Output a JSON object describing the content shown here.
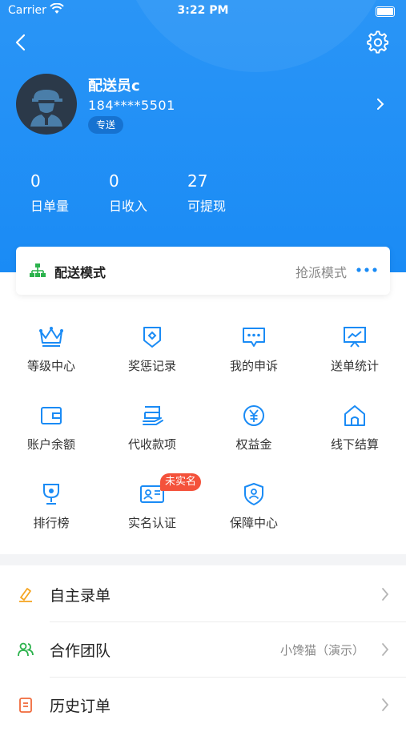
{
  "status_bar": {
    "carrier": "Carrier",
    "time": "3:22 PM"
  },
  "profile": {
    "name": "配送员c",
    "phone": "184****5501",
    "badge": "专送"
  },
  "stats": [
    {
      "value": "0",
      "label": "日单量"
    },
    {
      "value": "0",
      "label": "日收入"
    },
    {
      "value": "27",
      "label": "可提现"
    }
  ],
  "delivery_mode": {
    "title": "配送模式",
    "value": "抢派模式"
  },
  "grid": [
    {
      "label": "等级中心",
      "icon": "crown-icon"
    },
    {
      "label": "奖惩记录",
      "icon": "shield-badge-icon"
    },
    {
      "label": "我的申诉",
      "icon": "chat-bubble-icon"
    },
    {
      "label": "送单统计",
      "icon": "chart-board-icon"
    },
    {
      "label": "账户余额",
      "icon": "wallet-icon"
    },
    {
      "label": "代收款项",
      "icon": "collection-icon"
    },
    {
      "label": "权益金",
      "icon": "yuan-coin-icon"
    },
    {
      "label": "线下结算",
      "icon": "home-icon"
    },
    {
      "label": "排行榜",
      "icon": "trophy-icon"
    },
    {
      "label": "实名认证",
      "icon": "id-card-icon"
    },
    {
      "label": "保障中心",
      "icon": "shield-user-icon"
    }
  ],
  "verify_tag": "未实名",
  "menu": [
    {
      "label": "自主录单",
      "value": "",
      "icon": "pen-icon",
      "color": "#f5a623"
    },
    {
      "label": "合作团队",
      "value": "小馋猫（演示）",
      "icon": "team-icon",
      "color": "#2bb24c"
    },
    {
      "label": "历史订单",
      "value": "",
      "icon": "document-icon",
      "color": "#f06a3b"
    }
  ],
  "colors": {
    "primary": "#1a8bf5",
    "icon_blue": "#1a8bf5",
    "tag_red": "#f4523b"
  }
}
